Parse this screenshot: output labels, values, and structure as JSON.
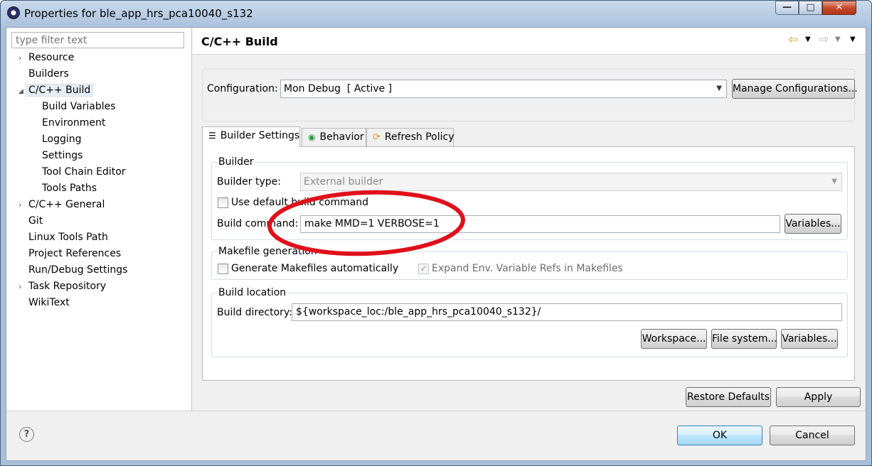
{
  "window": {
    "title": "Properties for ble_app_hrs_pca10040_s132",
    "controls": {
      "minimize": "—",
      "maximize": "□",
      "close": "✕"
    }
  },
  "filter": {
    "placeholder": "type filter text"
  },
  "tree": [
    {
      "label": "Resource",
      "expander": "›"
    },
    {
      "label": "Builders"
    },
    {
      "label": "C/C++ Build",
      "expander": "◢",
      "selected": true
    },
    {
      "label": "Build Variables"
    },
    {
      "label": "Environment"
    },
    {
      "label": "Logging"
    },
    {
      "label": "Settings"
    },
    {
      "label": "Tool Chain Editor"
    },
    {
      "label": "Tools Paths"
    },
    {
      "label": "C/C++ General",
      "expander": "›"
    },
    {
      "label": "Git"
    },
    {
      "label": "Linux Tools Path"
    },
    {
      "label": "Project References"
    },
    {
      "label": "Run/Debug Settings"
    },
    {
      "label": "Task Repository",
      "expander": "›"
    },
    {
      "label": "WikiText"
    }
  ],
  "page": {
    "title": "C/C++ Build",
    "configuration_label": "Configuration:",
    "configuration_value": "Mon Debug  [ Active ]",
    "manage_button": "Manage Configurations..."
  },
  "tabs": [
    {
      "label": "Builder Settings",
      "icon": "list-icon",
      "active": true
    },
    {
      "label": "Behavior",
      "icon": "radio-icon"
    },
    {
      "label": "Refresh Policy",
      "icon": "refresh-icon"
    }
  ],
  "builder": {
    "group_label": "Builder",
    "type_label": "Builder type:",
    "type_value": "External builder",
    "use_default_label": "Use default build command",
    "use_default_checked": false,
    "command_label": "Build command:",
    "command_value": "make MMD=1 VERBOSE=1",
    "variables_button": "Variables..."
  },
  "makefile": {
    "group_label": "Makefile generation",
    "generate_label": "Generate Makefiles automatically",
    "generate_checked": false,
    "expand_label": "Expand Env. Variable Refs in Makefiles",
    "expand_checked": true
  },
  "location": {
    "group_label": "Build location",
    "dir_label": "Build directory:",
    "dir_value": "${workspace_loc:/ble_app_hrs_pca10040_s132}/",
    "workspace_button": "Workspace...",
    "filesystem_button": "File system...",
    "variables_button": "Variables..."
  },
  "buttons": {
    "restore_defaults": "Restore Defaults",
    "apply": "Apply",
    "ok": "OK",
    "cancel": "Cancel",
    "help": "?"
  },
  "annotation": {
    "color": "#e0101a"
  }
}
